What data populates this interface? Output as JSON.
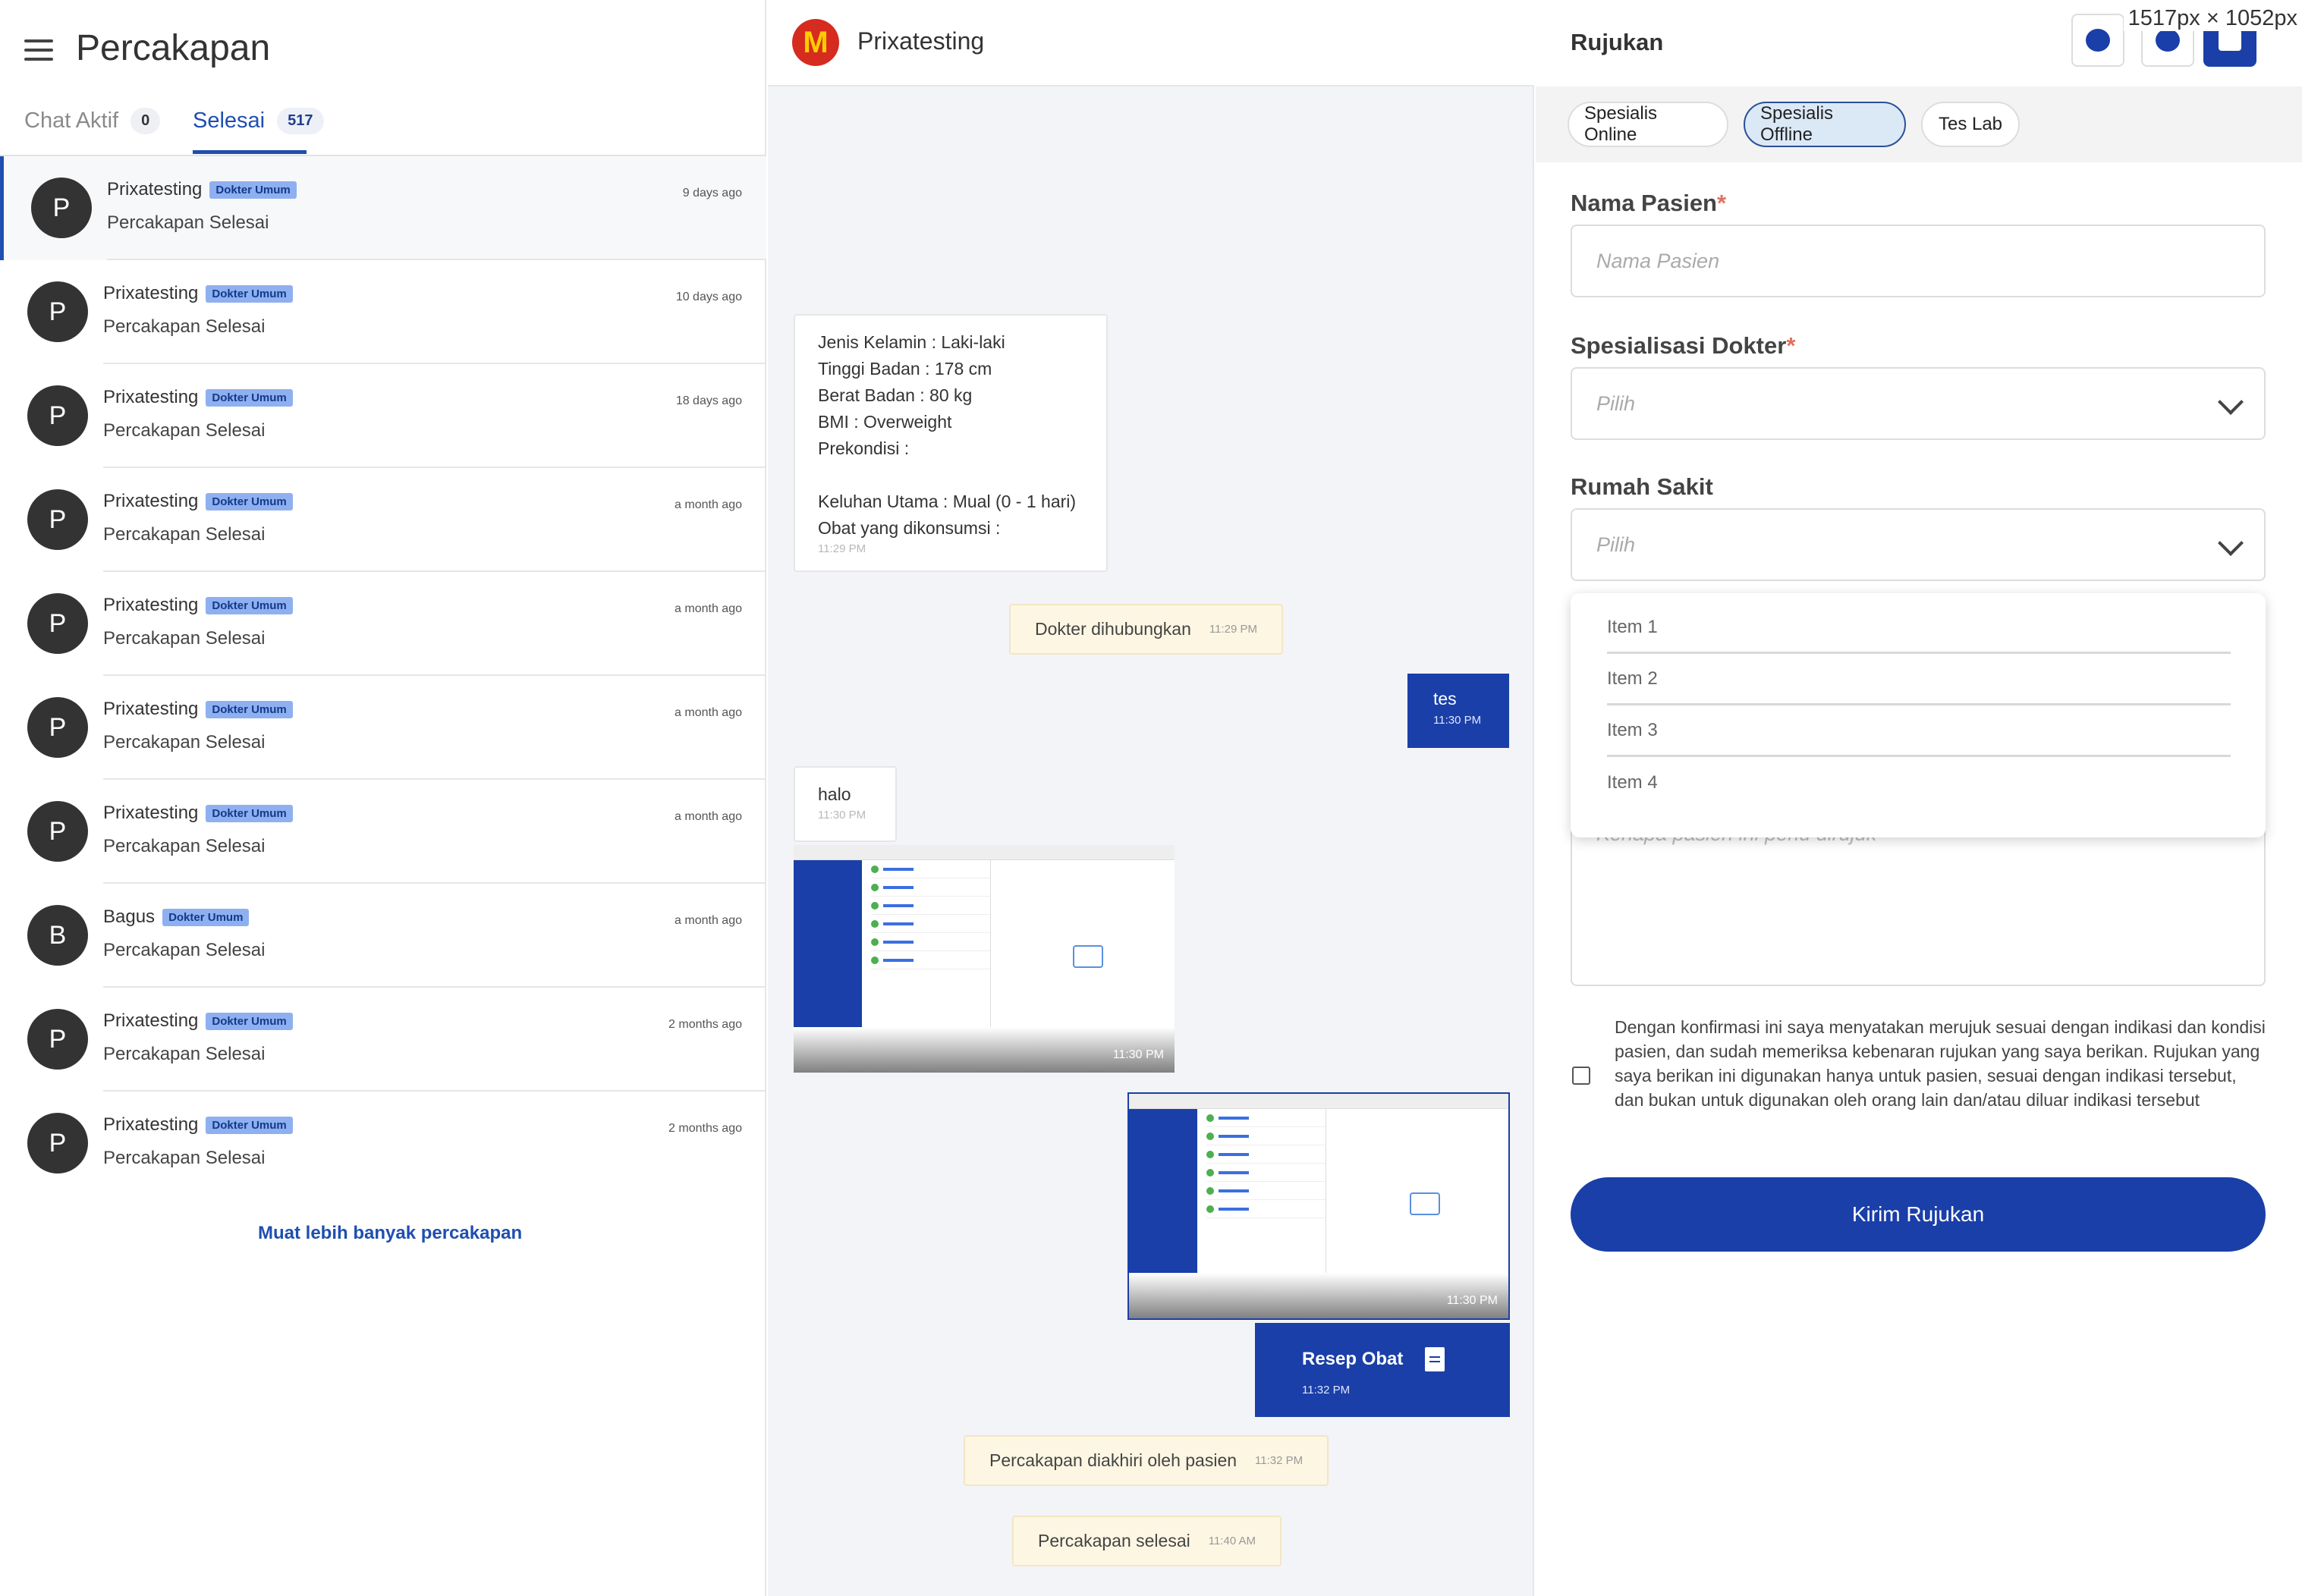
{
  "left": {
    "title": "Percakapan",
    "tabs": [
      {
        "label": "Chat Aktif",
        "count": "0"
      },
      {
        "label": "Selesai",
        "count": "517"
      }
    ],
    "conversations": [
      {
        "initial": "P",
        "name": "Prixatesting",
        "badge": "Dokter Umum",
        "subtitle": "Percakapan Selesai",
        "time": "9 days ago"
      },
      {
        "initial": "P",
        "name": "Prixatesting",
        "badge": "Dokter Umum",
        "subtitle": "Percakapan Selesai",
        "time": "10 days ago"
      },
      {
        "initial": "P",
        "name": "Prixatesting",
        "badge": "Dokter Umum",
        "subtitle": "Percakapan Selesai",
        "time": "18 days ago"
      },
      {
        "initial": "P",
        "name": "Prixatesting",
        "badge": "Dokter Umum",
        "subtitle": "Percakapan Selesai",
        "time": "a month ago"
      },
      {
        "initial": "P",
        "name": "Prixatesting",
        "badge": "Dokter Umum",
        "subtitle": "Percakapan Selesai",
        "time": "a month ago"
      },
      {
        "initial": "P",
        "name": "Prixatesting",
        "badge": "Dokter Umum",
        "subtitle": "Percakapan Selesai",
        "time": "a month ago"
      },
      {
        "initial": "P",
        "name": "Prixatesting",
        "badge": "Dokter Umum",
        "subtitle": "Percakapan Selesai",
        "time": "a month ago"
      },
      {
        "initial": "B",
        "name": "Bagus",
        "badge": "Dokter Umum",
        "subtitle": "Percakapan Selesai",
        "time": "a month ago"
      },
      {
        "initial": "P",
        "name": "Prixatesting",
        "badge": "Dokter Umum",
        "subtitle": "Percakapan Selesai",
        "time": "2 months ago"
      },
      {
        "initial": "P",
        "name": "Prixatesting",
        "badge": "Dokter Umum",
        "subtitle": "Percakapan Selesai",
        "time": "2 months ago"
      }
    ],
    "load_more": "Muat lebih banyak percakapan"
  },
  "chat": {
    "title": "Prixatesting",
    "patient_info": {
      "lines": [
        "Jenis Kelamin : Laki-laki",
        "Tinggi Badan : 178 cm",
        "Berat Badan : 80 kg",
        "BMI : Overweight",
        "Prekondisi :",
        "",
        "Keluhan Utama : Mual (0 - 1 hari)",
        "Obat yang dikonsumsi :"
      ],
      "time": "11:29 PM"
    },
    "sys_contacted": {
      "text": "Dokter dihubungkan",
      "time": "11:29 PM"
    },
    "out_msg": {
      "text": "tes",
      "time": "11:30 PM"
    },
    "in_msg": {
      "text": "halo",
      "time": "11:30 PM"
    },
    "image_in_time": "11:30 PM",
    "image_out_time": "11:30 PM",
    "recipe": {
      "text": "Resep Obat",
      "time": "11:32 PM"
    },
    "sys_ended_by_patient": {
      "text": "Percakapan diakhiri oleh pasien",
      "time": "11:32 PM"
    },
    "sys_finished": {
      "text": "Percakapan selesai",
      "time": "11:40 AM"
    }
  },
  "right": {
    "title": "Rujukan",
    "dims_label": "1517px × 1052px",
    "chips": [
      "Spesialis Online",
      "Spesialis Offline",
      "Tes Lab"
    ],
    "active_chip": "Spesialis Offline",
    "fields": {
      "nama_label": "Nama Pasien",
      "nama_placeholder": "Nama Pasien",
      "spesialisasi_label": "Spesialisasi Dokter",
      "spesialisasi_placeholder": "Pilih",
      "rumah_sakit_label": "Rumah Sakit",
      "rumah_sakit_placeholder": "Pilih",
      "required_mark": "*"
    },
    "dropdown_items": [
      "Item 1",
      "Item 2",
      "Item 3",
      "Item 4"
    ],
    "textarea_placeholder": "Kenapa pasien ini perlu dirujuk",
    "consent_text": "Dengan konfirmasi ini saya menyatakan merujuk sesuai dengan indikasi dan kondisi pasien, dan sudah memeriksa kebenaran rujukan yang saya berikan. Rujukan yang saya berikan ini digunakan hanya untuk pasien, sesuai dengan indikasi tersebut, dan bukan untuk digunakan oleh orang lain dan/atau diluar indikasi tersebut",
    "submit_label": "Kirim Rujukan"
  },
  "colors": {
    "primary": "#1a3fa8",
    "badge": "#8fb0f0",
    "system_bubble": "#fdf6e3",
    "required": "#e07060"
  },
  "icons": {
    "header_buttons": [
      "chat-add-icon",
      "user-icon",
      "referral-icon"
    ],
    "menu": "hamburger-icon",
    "recipe": "document-icon",
    "select": "chevron-down-icon"
  }
}
